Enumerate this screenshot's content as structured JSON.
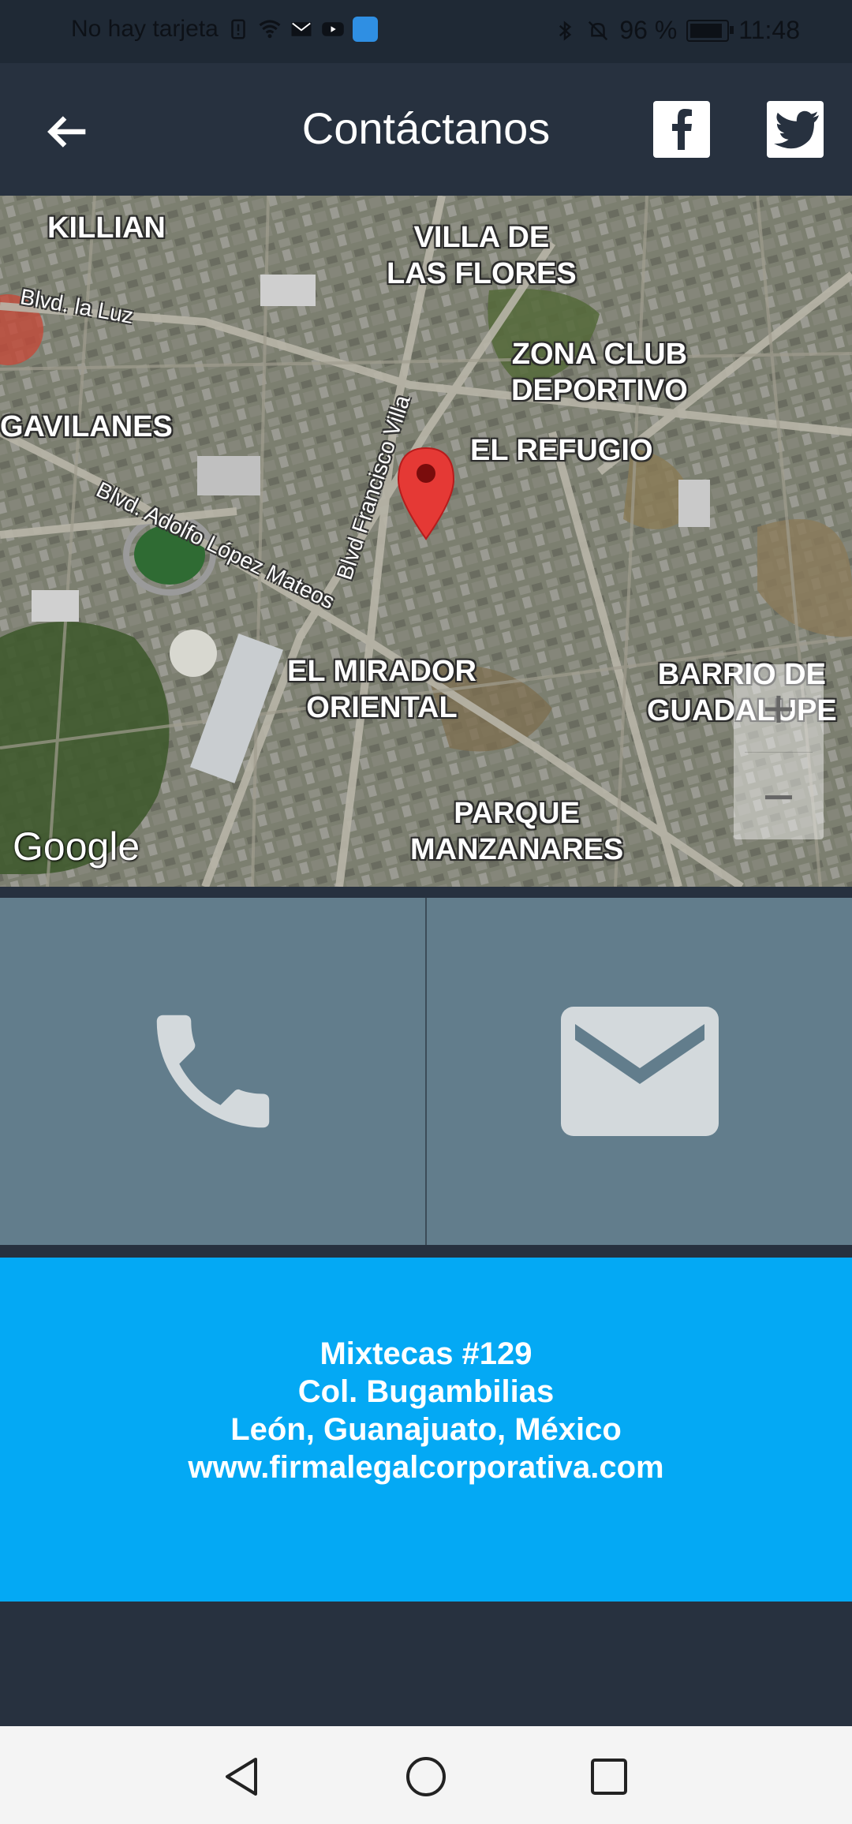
{
  "status_bar": {
    "carrier": "No hay tarjeta",
    "battery": "96 %",
    "time": "11:48",
    "battery_level": 0.96,
    "icons": [
      "sim-missing-icon",
      "wifi-icon",
      "gmail-icon",
      "youtube-icon",
      "app-icon",
      "bluetooth-icon",
      "mute-icon",
      "battery-icon"
    ]
  },
  "header": {
    "title": "Contáctanos",
    "back_icon": "arrow-left-icon",
    "social": [
      "facebook-icon",
      "twitter-icon"
    ]
  },
  "map": {
    "provider": "Google",
    "labels": {
      "killian": "KILLIAN",
      "villa": "VILLA DE\nLAS FLORES",
      "zona": "ZONA CLUB\nDEPORTIVO",
      "gavilanes": "GAVILANES",
      "refugio": "EL REFUGIO",
      "mirador": "EL MIRADOR\nORIENTAL",
      "barrio": "BARRIO DE\nGUADALUPE",
      "parque": "PARQUE\nMANZANARES"
    },
    "roads": {
      "la_luz": "Blvd. la Luz",
      "lopez_mateos": "Blvd. Adolfo López Mateos",
      "francisco_villa": "Blvd Francisco Villa"
    },
    "zoom_in": "+",
    "zoom_out": "−",
    "colors": {
      "pin": "#e53935"
    }
  },
  "actions": {
    "phone_icon": "phone-icon",
    "mail_icon": "mail-icon"
  },
  "address": {
    "line1": "Mixtecas #129",
    "line2": "Col. Bugambilias",
    "line3": "León, Guanajuato, México",
    "line4": "www.firmalegalcorporativa.com"
  },
  "nav": {
    "icons": [
      "back-triangle-icon",
      "home-circle-icon",
      "recents-square-icon"
    ]
  },
  "colors": {
    "header_bg": "#27313f",
    "action_bg": "#627d8c",
    "address_bg": "#04a9f4"
  }
}
